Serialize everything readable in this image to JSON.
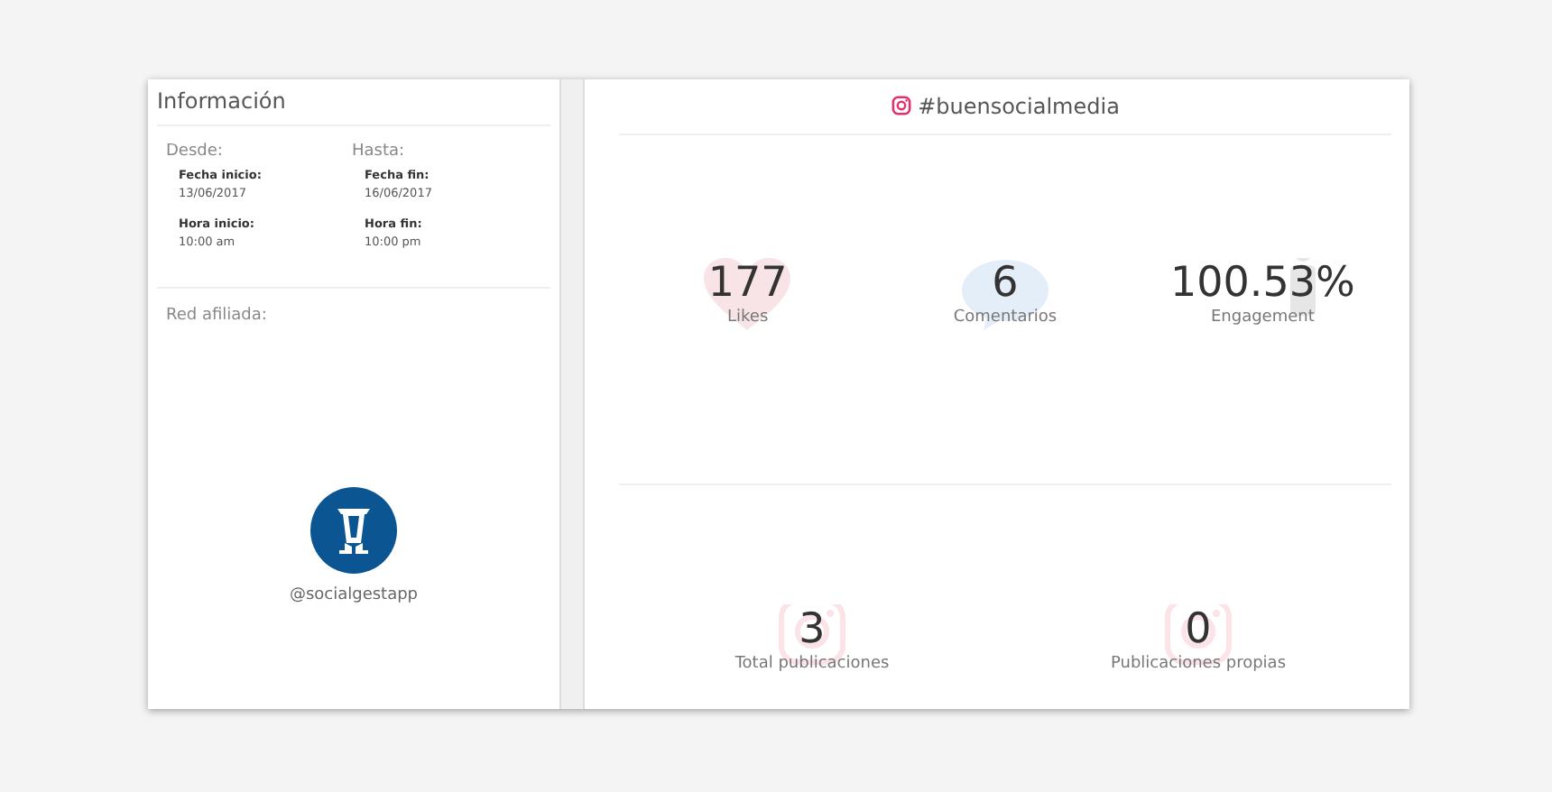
{
  "info": {
    "title": "Información",
    "from": {
      "heading": "Desde:",
      "date_label": "Fecha inicio:",
      "date": "13/06/2017",
      "time_label": "Hora inicio:",
      "time": "10:00 am"
    },
    "to": {
      "heading": "Hasta:",
      "date_label": "Fecha fin:",
      "date": "16/06/2017",
      "time_label": "Hora fin:",
      "time": "10:00 pm"
    },
    "network_label": "Red afiliada:",
    "account": "@socialgestapp"
  },
  "hashtag": "#buensocialmedia",
  "stats_top": [
    {
      "kind": "heart",
      "value": "177",
      "label": "Likes"
    },
    {
      "kind": "bubble",
      "value": "6",
      "label": "Comentarios"
    },
    {
      "kind": "person",
      "value": "100.53%",
      "label": "Engagement"
    }
  ],
  "stats_bottom": [
    {
      "kind": "camera",
      "value": "3",
      "label": "Total publicaciones"
    },
    {
      "kind": "camera",
      "value": "0",
      "label": "Publicaciones propias"
    }
  ]
}
